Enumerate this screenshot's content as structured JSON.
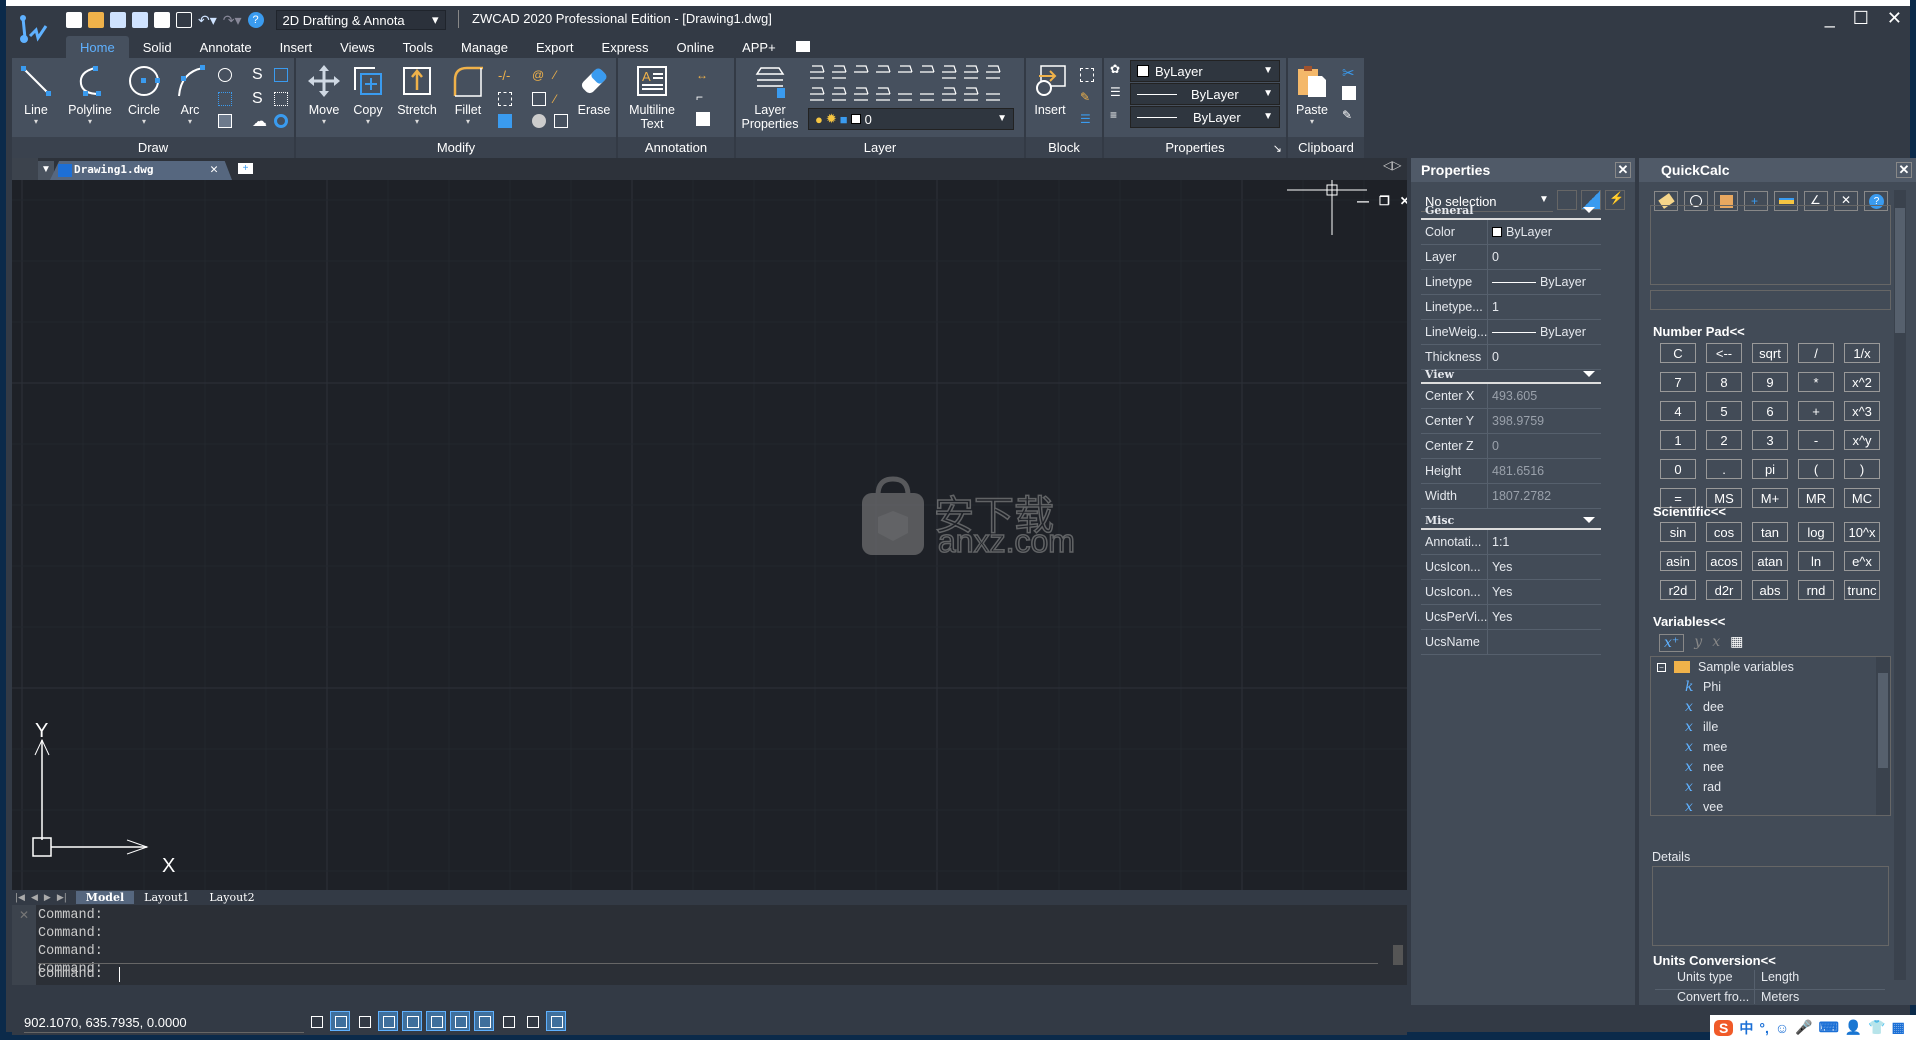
{
  "app": {
    "title": "ZWCAD 2020 Professional Edition - [Drawing1.dwg]",
    "workspace": "2D Drafting & Annota",
    "window_controls": [
      "minimize-icon",
      "maximize-icon",
      "close-icon"
    ]
  },
  "quick_access": [
    "new-icon",
    "open-icon",
    "save-icon",
    "save-as-icon",
    "print-icon",
    "plot-preview-icon",
    "undo-icon",
    "redo-icon",
    "help-icon"
  ],
  "ribbon": {
    "tabs": [
      "Home",
      "Solid",
      "Annotate",
      "Insert",
      "Views",
      "Tools",
      "Manage",
      "Export",
      "Express",
      "Online",
      "APP+"
    ],
    "active_tab": "Home",
    "panels": {
      "draw": {
        "label": "Draw",
        "tools": [
          "Line",
          "Polyline",
          "Circle",
          "Arc"
        ]
      },
      "modify": {
        "label": "Modify",
        "tools": [
          "Move",
          "Copy",
          "Stretch",
          "Fillet",
          "Erase"
        ]
      },
      "annotation": {
        "label": "Annotation",
        "tools": [
          "Multiline",
          "Text"
        ]
      },
      "layer": {
        "label": "Layer",
        "tools": [
          "Layer",
          "Properties"
        ],
        "current_layer": "0"
      },
      "block": {
        "label": "Block",
        "tools": [
          "Insert"
        ]
      },
      "properties": {
        "label": "Properties",
        "color": "ByLayer",
        "linetype": "ByLayer",
        "lineweight": "ByLayer"
      },
      "clipboard": {
        "label": "Clipboard",
        "tools": [
          "Paste"
        ]
      }
    }
  },
  "document": {
    "tab_name": "Drawing1.dwg",
    "layout_tabs": [
      "Model",
      "Layout1",
      "Layout2"
    ],
    "active_layout": "Model",
    "ucs": {
      "x_label": "X",
      "y_label": "Y"
    },
    "watermark": {
      "cn": "安下载",
      "url": "anxz.com"
    }
  },
  "command": {
    "history": [
      "Command:",
      "Command:",
      "Command:",
      "Command:"
    ],
    "prompt": "Command:"
  },
  "status": {
    "coordinates": "902.1070, 635.7935, 0.0000",
    "toggles": [
      {
        "name": "grid-display",
        "on": false
      },
      {
        "name": "snap-mode",
        "on": true
      },
      {
        "name": "ortho-mode",
        "on": false
      },
      {
        "name": "polar-tracking",
        "on": true
      },
      {
        "name": "object-snap",
        "on": true
      },
      {
        "name": "object-snap-tracking",
        "on": true
      },
      {
        "name": "dynamic-ucs",
        "on": true
      },
      {
        "name": "dynamic-input",
        "on": true
      },
      {
        "name": "lineweight",
        "on": false
      },
      {
        "name": "transparency",
        "on": false
      },
      {
        "name": "selection-cycling",
        "on": true
      }
    ]
  },
  "properties_panel": {
    "title": "Properties",
    "selection": "No selection",
    "groups": [
      {
        "name": "General",
        "rows": [
          {
            "k": "Color",
            "v": "ByLayer",
            "type": "swatch"
          },
          {
            "k": "Layer",
            "v": "0"
          },
          {
            "k": "Linetype",
            "v": "ByLayer",
            "type": "line"
          },
          {
            "k": "Linetype...",
            "v": "1"
          },
          {
            "k": "LineWeig...",
            "v": "ByLayer",
            "type": "line"
          },
          {
            "k": "Thickness",
            "v": "0"
          }
        ]
      },
      {
        "name": "View",
        "rows": [
          {
            "k": "Center X",
            "v": "493.605",
            "dim": true
          },
          {
            "k": "Center Y",
            "v": "398.9759",
            "dim": true
          },
          {
            "k": "Center Z",
            "v": "0",
            "dim": true
          },
          {
            "k": "Height",
            "v": "481.6516",
            "dim": true
          },
          {
            "k": "Width",
            "v": "1807.2782",
            "dim": true
          }
        ]
      },
      {
        "name": "Misc",
        "rows": [
          {
            "k": "Annotati...",
            "v": "1:1"
          },
          {
            "k": "UcsIcon...",
            "v": "Yes"
          },
          {
            "k": "UcsIcon...",
            "v": "Yes"
          },
          {
            "k": "UcsPerVi...",
            "v": "Yes"
          },
          {
            "k": "UcsName",
            "v": ""
          }
        ]
      }
    ]
  },
  "quickcalc": {
    "title": "QuickCalc",
    "toolbar": [
      "clear-icon",
      "history-icon",
      "paste-to-command-icon",
      "get-coordinates-icon",
      "distance-icon",
      "angle-icon",
      "intersection-icon",
      "help-icon"
    ],
    "number_pad_label": "Number Pad<<",
    "number_pad": [
      "C",
      "<--",
      "sqrt",
      "/",
      "1/x",
      "7",
      "8",
      "9",
      "*",
      "x^2",
      "4",
      "5",
      "6",
      "+",
      "x^3",
      "1",
      "2",
      "3",
      "-",
      "x^y",
      "0",
      ".",
      "pi",
      "(",
      ")",
      "=",
      "MS",
      "M+",
      "MR",
      "MC"
    ],
    "scientific_label": "Scientific<<",
    "scientific": [
      "sin",
      "cos",
      "tan",
      "log",
      "10^x",
      "asin",
      "acos",
      "atan",
      "ln",
      "e^x",
      "r2d",
      "d2r",
      "abs",
      "rnd",
      "trunc"
    ],
    "variables_label": "Variables<<",
    "variable_folder": "Sample variables",
    "variables": [
      {
        "kind": "k",
        "name": "Phi"
      },
      {
        "kind": "x",
        "name": "dee"
      },
      {
        "kind": "x",
        "name": "ille"
      },
      {
        "kind": "x",
        "name": "mee"
      },
      {
        "kind": "x",
        "name": "nee"
      },
      {
        "kind": "x",
        "name": "rad"
      },
      {
        "kind": "x",
        "name": "vee"
      }
    ],
    "details_label": "Details",
    "units_label": "Units Conversion<<",
    "units": [
      {
        "k": "Units type",
        "v": "Length"
      },
      {
        "k": "Convert fro...",
        "v": "Meters"
      }
    ]
  },
  "ime": {
    "logo": "S",
    "items": [
      "中",
      "°,",
      "☺",
      "🎤",
      "⌨",
      "👤",
      "👕",
      "▦"
    ]
  },
  "colors": {
    "accent": "#5fb1ff",
    "panel": "#424b57",
    "canvas": "#1e2127"
  }
}
